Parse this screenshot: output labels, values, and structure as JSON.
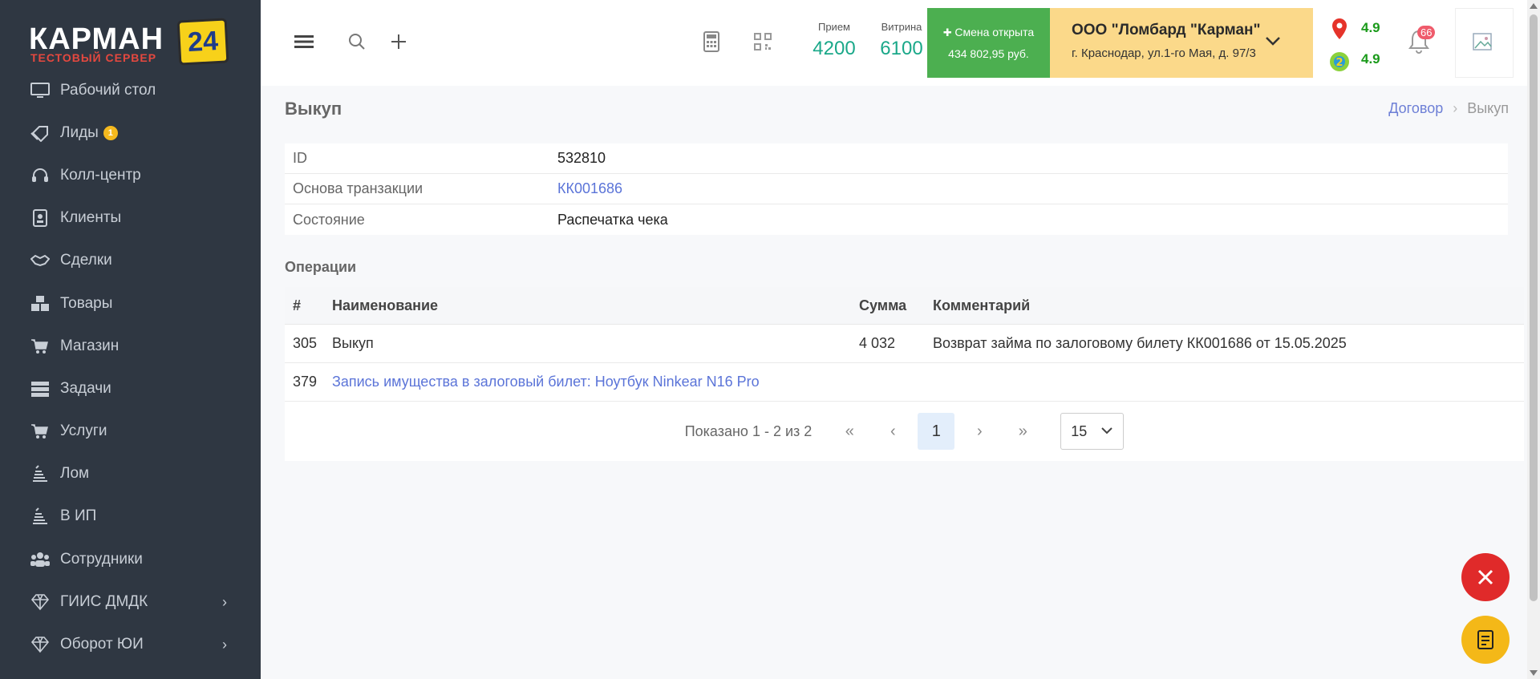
{
  "logo": {
    "brand": "КАРМАН",
    "badge": "24",
    "subtitle": "ТЕСТОВЫЙ СЕРВЕР"
  },
  "sidebar": {
    "items": [
      {
        "label": "Рабочий стол",
        "icon": "monitor-icon"
      },
      {
        "label": "Лиды",
        "icon": "tag-icon",
        "count": "1"
      },
      {
        "label": "Колл-центр",
        "icon": "headset-icon"
      },
      {
        "label": "Клиенты",
        "icon": "contact-card-icon"
      },
      {
        "label": "Сделки",
        "icon": "handshake-icon"
      },
      {
        "label": "Товары",
        "icon": "boxes-icon"
      },
      {
        "label": "Магазин",
        "icon": "cart-icon"
      },
      {
        "label": "Задачи",
        "icon": "tasks-icon"
      },
      {
        "label": "Услуги",
        "icon": "cart-icon"
      },
      {
        "label": "Лом",
        "icon": "scrap-icon"
      },
      {
        "label": "В ИП",
        "icon": "scrap-icon"
      },
      {
        "label": "Сотрудники",
        "icon": "users-icon"
      },
      {
        "label": "ГИИС ДМДК",
        "icon": "diamond-icon",
        "expandable": true
      },
      {
        "label": "Оборот ЮИ",
        "icon": "diamond-icon",
        "expandable": true
      }
    ]
  },
  "header": {
    "stats": [
      {
        "label": "Прием",
        "value": "4200"
      },
      {
        "label": "Витрина",
        "value": "6100"
      }
    ],
    "shift": {
      "title": "Смена открыта",
      "amount": "434 802,95 руб."
    },
    "org": {
      "name": "ООО \"Ломбард \"Карман\"",
      "address": "г. Краснодар, ул.1-го Мая, д. 97/3"
    },
    "ratings": [
      "4.9",
      "4.9"
    ],
    "notifications": "66"
  },
  "page": {
    "title": "Выкуп",
    "breadcrumb": {
      "parent": "Договор",
      "current": "Выкуп"
    }
  },
  "info": {
    "rows": [
      {
        "key": "ID",
        "value": "532810"
      },
      {
        "key": "Основа транзакции",
        "value": "КК001686"
      },
      {
        "key": "Состояние",
        "value": "Распечатка чека"
      }
    ]
  },
  "operations": {
    "title": "Операции",
    "columns": [
      "#",
      "Наименование",
      "Сумма",
      "Комментарий"
    ],
    "rows": [
      {
        "num": "305",
        "name": "Выкуп",
        "sum": "4 032",
        "comment": "Возврат займа по залоговому билету КК001686 от 15.05.2025"
      },
      {
        "num": "379",
        "name": "Запись имущества в залоговый билет: Ноутбук Ninkear N16 Pro",
        "sum": "",
        "comment": ""
      }
    ]
  },
  "pagination": {
    "summary": "Показано 1 - 2 из 2",
    "current": "1",
    "page_size": "15"
  }
}
